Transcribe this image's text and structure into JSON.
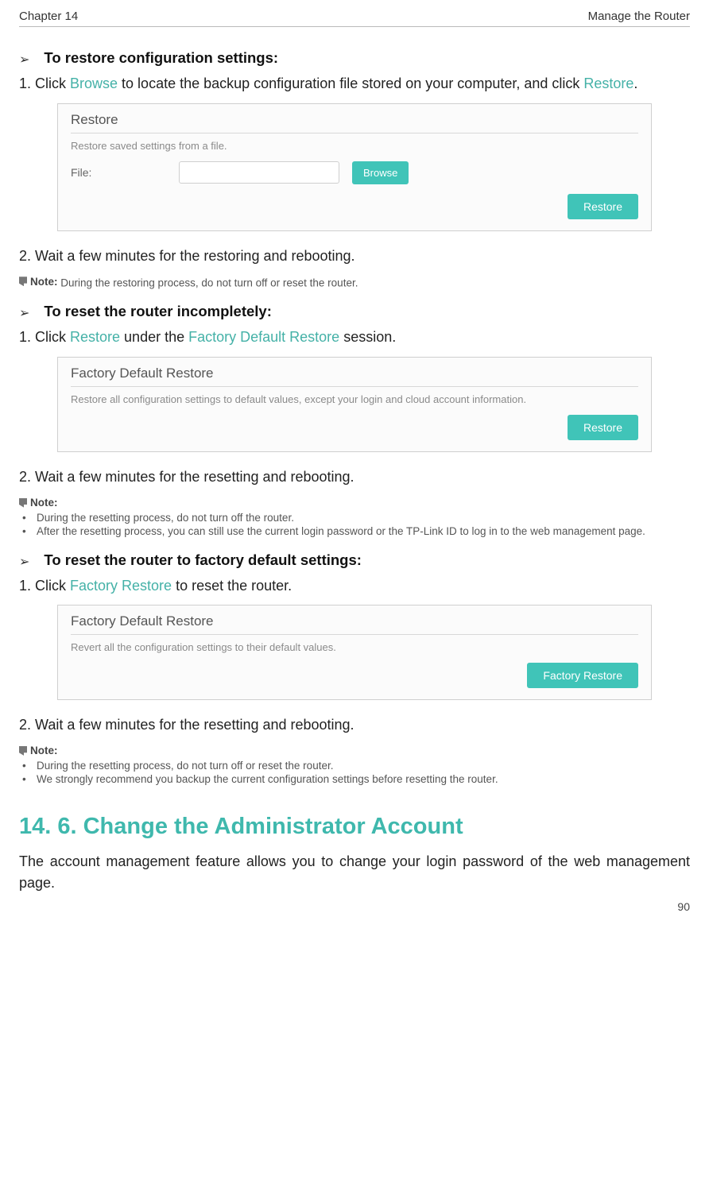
{
  "header": {
    "left": "Chapter 14",
    "right": "Manage the Router"
  },
  "s1": {
    "title": "To restore configuration settings:",
    "step1_pre": "1. Click ",
    "step1_kw1": "Browse",
    "step1_mid": " to locate the backup configuration file stored on your computer, and click ",
    "step1_kw2": "Restore",
    "step1_post": ".",
    "panel": {
      "title": "Restore",
      "sub": "Restore saved settings from a file.",
      "file_label": "File:",
      "browse_btn": "Browse",
      "restore_btn": "Restore"
    },
    "step2": "2. Wait a few minutes for the restoring and rebooting.",
    "note_label": "Note:",
    "note_text": " During the restoring process, do not turn off or reset the router."
  },
  "s2": {
    "title": "To reset the router incompletely:",
    "step1_pre": "1. Click ",
    "step1_kw1": "Restore",
    "step1_mid": " under the ",
    "step1_kw2": "Factory Default Restore",
    "step1_post": " session.",
    "panel": {
      "title": "Factory Default Restore",
      "sub": "Restore all configuration settings to default values, except your login and cloud account information.",
      "restore_btn": "Restore"
    },
    "step2": "2. Wait a few minutes for the resetting and rebooting.",
    "note_label": "Note:",
    "note_b1": "During the resetting process, do not turn off the router.",
    "note_b2": "After the resetting process, you can still use the current login password or the TP-Link ID to log in to the web management page."
  },
  "s3": {
    "title": "To reset the router to factory default settings:",
    "step1_pre": "1. Click ",
    "step1_kw1": "Factory Restore",
    "step1_post": " to reset the router.",
    "panel": {
      "title": "Factory Default Restore",
      "sub": "Revert all the configuration settings to their default values.",
      "btn": "Factory Restore"
    },
    "step2": "2. Wait a few minutes for the resetting and rebooting.",
    "note_label": "Note:",
    "note_b1": "During the resetting process, do not turn off or reset the router.",
    "note_b2": "We strongly recommend you backup the current configuration settings before resetting the router."
  },
  "s4": {
    "heading": "14. 6.   Change the Administrator Account",
    "body": "The account management feature allows you to change your login password of the web management page."
  },
  "page_number": "90"
}
